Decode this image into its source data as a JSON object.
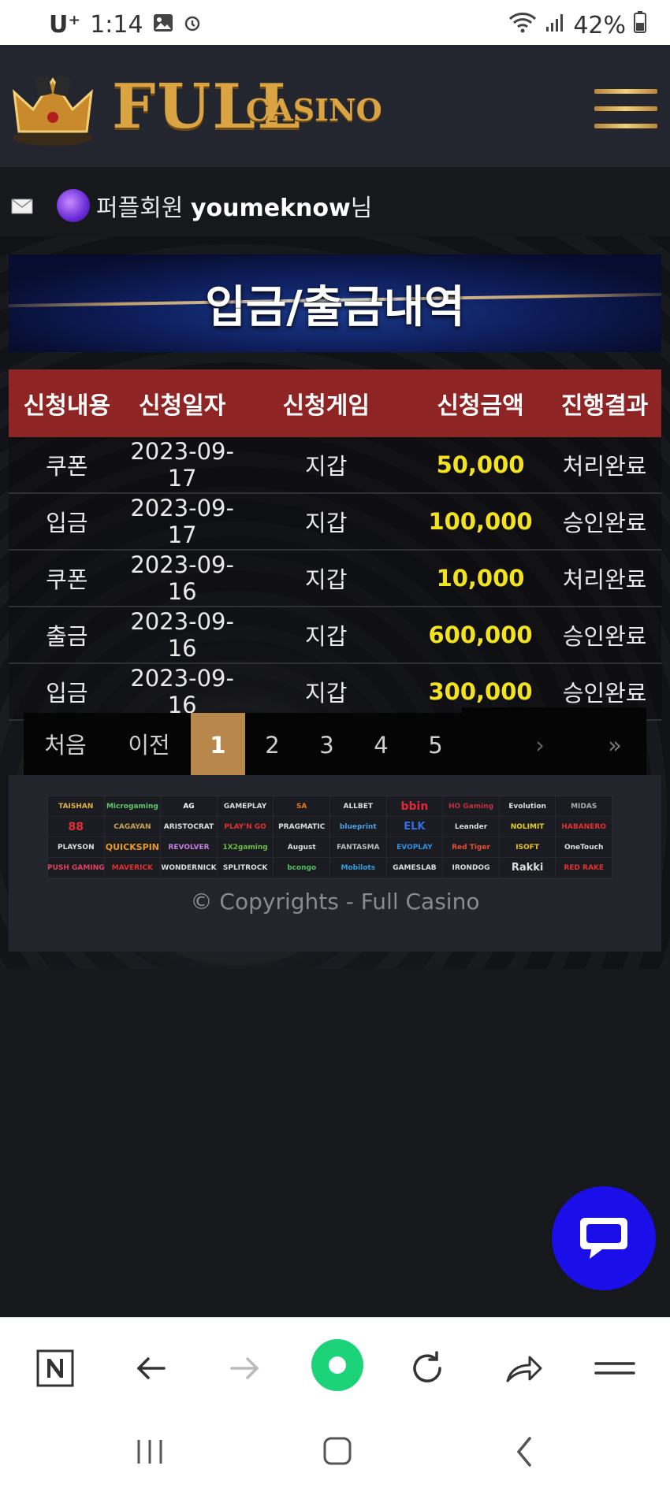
{
  "status_bar": {
    "carrier": "U⁺",
    "time": "1:14",
    "battery": "42%"
  },
  "header": {
    "logo_main": "FULL",
    "logo_sub": "CASINO"
  },
  "user": {
    "grade": "퍼플회원",
    "username": "youmeknow",
    "suffix": "님"
  },
  "banner": {
    "title": "입금/출금내역"
  },
  "table": {
    "headers": [
      "신청내용",
      "신청일자",
      "신청게임",
      "신청금액",
      "진행결과"
    ],
    "rows": [
      [
        "쿠폰",
        "2023-09-17",
        "지갑",
        "50,000",
        "처리완료"
      ],
      [
        "입금",
        "2023-09-17",
        "지갑",
        "100,000",
        "승인완료"
      ],
      [
        "쿠폰",
        "2023-09-16",
        "지갑",
        "10,000",
        "처리완료"
      ],
      [
        "출금",
        "2023-09-16",
        "지갑",
        "600,000",
        "승인완료"
      ],
      [
        "입금",
        "2023-09-16",
        "지갑",
        "300,000",
        "승인완료"
      ]
    ]
  },
  "pagination": {
    "first": "처음",
    "prev": "이전",
    "pages": [
      "1",
      "2",
      "3",
      "4",
      "5"
    ],
    "active_page": "1",
    "next": "›",
    "last": "»"
  },
  "providers": [
    "TAISHAN",
    "Microgaming",
    "AG",
    "GAMEPLAY",
    "SA",
    "ALLBET",
    "bbin",
    "HO Gaming",
    "Evolution",
    "MIDAS",
    "88",
    "CAGAYAN",
    "ARISTOCRAT",
    "PLAY'N GO",
    "PRAGMATIC",
    "blueprint",
    "ELK",
    "Leander",
    "NOLIMIT",
    "HABANERO",
    "PLAYSON",
    "QUICKSPIN",
    "REVOLVER",
    "1X2gaming",
    "August",
    "FANTASMA",
    "EVOPLAY",
    "Red Tiger",
    "ISOFT",
    "OneTouch",
    "PUSH GAMING",
    "MAVERICK",
    "WONDERNICK",
    "SPLITROCK",
    "bcongo",
    "Mobilots",
    "GAMESLAB",
    "IRONDOG",
    "Rakki",
    "RED RAKE"
  ],
  "footer": {
    "copyright": "© Copyrights - Full Casino"
  },
  "colors": {
    "header_bg": "#23262f",
    "table_header": "#8f2424",
    "amount": "#f3e21e",
    "active_page": "#b8874b",
    "chat_button": "#1a0fe8"
  }
}
